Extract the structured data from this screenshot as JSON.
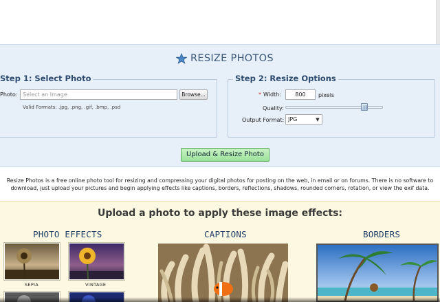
{
  "header": {
    "title": "RESIZE PHOTOS"
  },
  "step1": {
    "legend": "Step 1: Select Photo",
    "photo_label": "Photo:",
    "photo_placeholder": "Select an Image",
    "browse_label": "Browse...",
    "valid_formats": "Valid Formats: .jpg, .png, .gif, .bmp, .psd"
  },
  "step2": {
    "legend": "Step 2: Resize Options",
    "width_required": "*",
    "width_label": "Width:",
    "width_value": "800",
    "width_unit": "pixels",
    "quality_label": "Quality:",
    "quality_value": 0.83,
    "format_label": "Output Format:",
    "format_value": "JPG"
  },
  "upload_button": "Upload & Resize Photo",
  "description_line1": "Resize Photos is a free online photo tool for resizing and compressing your digital photos for posting on the web, in email or on forums. There is no software to",
  "description_line2": "download, just upload your pictures and begin applying effects like captions, borders, reflections, shadows, rounded corners, rotation, or view the exif data.",
  "effects": {
    "heading": "Upload a photo to apply these image effects:",
    "photo_effects_title": "PHOTO EFFECTS",
    "captions_title": "CAPTIONS",
    "borders_title": "BORDERS",
    "thumbs": [
      {
        "label": "SEPIA"
      },
      {
        "label": "VINTAGE"
      }
    ]
  },
  "colors": {
    "panel_bg": "#e7eff8",
    "title_blue": "#3d5877",
    "legend_blue": "#2b4a6e",
    "upload_green": "#9be29a",
    "effects_bg": "#fdf8e1"
  }
}
